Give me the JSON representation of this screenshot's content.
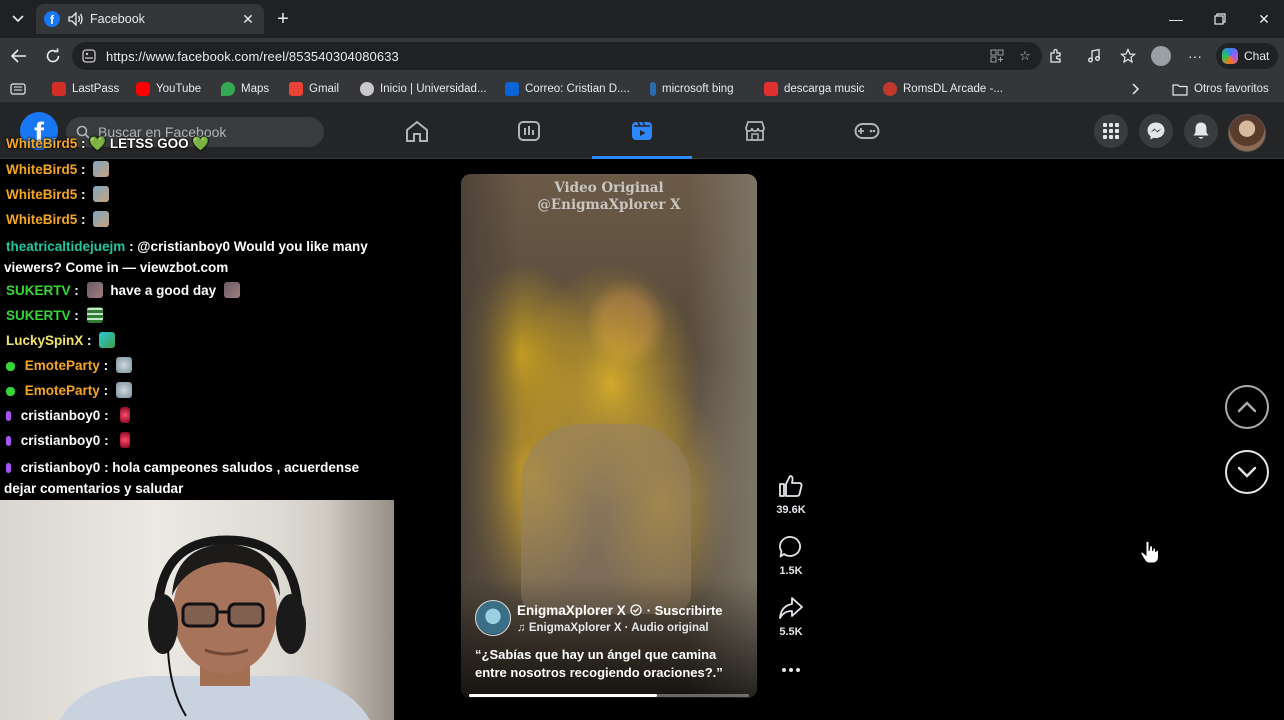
{
  "browser": {
    "tab_title": "Facebook",
    "url": "https://www.facebook.com/reel/853540304080633",
    "copilot_label": "Chat",
    "bookmarks": [
      {
        "label": "LastPass",
        "color": "#d32d27"
      },
      {
        "label": "YouTube",
        "color": "#ff0000"
      },
      {
        "label": "Maps",
        "color": "#34a853"
      },
      {
        "label": "Gmail",
        "color": "#ea4335"
      },
      {
        "label": "Inicio | Universidad...",
        "color": "#c9c9c9"
      },
      {
        "label": "Correo: Cristian D....",
        "color": "#0a64d6"
      },
      {
        "label": "microsoft bing",
        "color": "#2b6cb0"
      },
      {
        "label": "descarga music",
        "color": "#e03131"
      },
      {
        "label": "RomsDL Arcade -...",
        "color": "#c0392b"
      }
    ],
    "other_favorites": "Otros favoritos"
  },
  "facebook": {
    "logo_letter": "f",
    "search_placeholder": "Buscar en Facebook"
  },
  "chat": [
    {
      "user": "WhiteBird5",
      "color": "#f5a623",
      "text": ": 💚 LETSS GOO 💚"
    },
    {
      "user": "WhiteBird5",
      "color": "#f5a623",
      "text": ":"
    },
    {
      "user": "WhiteBird5",
      "color": "#f5a623",
      "text": ":"
    },
    {
      "user": "WhiteBird5",
      "color": "#f5a623",
      "text": ":"
    },
    {
      "user": "theatricaltidejuejm",
      "color": "#1fc7a0",
      "text": ": @cristianboy0 Would you like many viewers? Come in — viewzbot.com"
    },
    {
      "user": "SUKERTV",
      "color": "#35d635",
      "text": ":",
      "extra": "have a good day"
    },
    {
      "user": "SUKERTV",
      "color": "#35d635",
      "text": ":"
    },
    {
      "user": "LuckySpinX",
      "color": "#f3e36b",
      "text": ":"
    },
    {
      "user": "EmoteParty",
      "color": "#f5a623",
      "text": ":"
    },
    {
      "user": "EmoteParty",
      "color": "#f5a623",
      "text": ":"
    },
    {
      "user": "cristianboy0",
      "color": "#ffffff",
      "text": ":"
    },
    {
      "user": "cristianboy0",
      "color": "#ffffff",
      "text": ":"
    },
    {
      "user": "cristianboy0",
      "color": "#ffffff",
      "text": ": hola campeones saludos , acuerdense dejar comentarios y saludar"
    }
  ],
  "reel": {
    "watermark_line1": "Video Original",
    "watermark_line2": "@EnigmaXplorer X",
    "author": "EnigmaXplorer X",
    "subscribe": "· Suscribirte",
    "audio": "EnigmaXplorer X · Audio original",
    "caption": "“¿Sabías que hay un ángel que camina entre nosotros recogiendo oraciones?.”",
    "progress_percent": 67,
    "likes": "39.6K",
    "comments": "1.5K",
    "shares": "5.5K"
  }
}
